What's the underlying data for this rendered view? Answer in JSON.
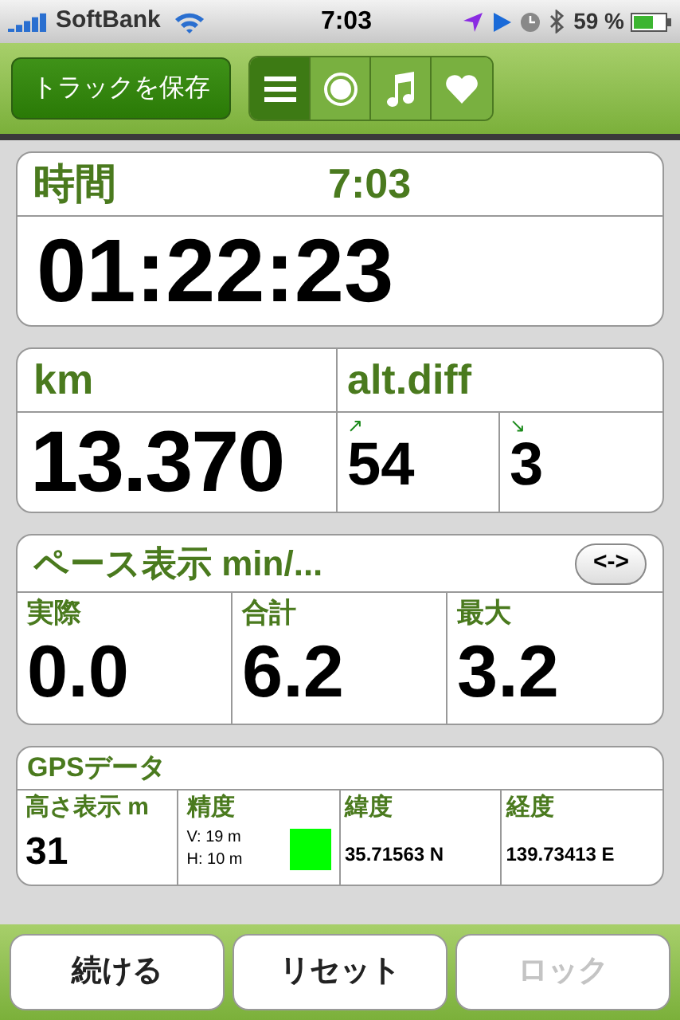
{
  "status_bar": {
    "carrier": "SoftBank",
    "time": "7:03",
    "battery": "59 %"
  },
  "toolbar": {
    "save_button": "トラックを保存",
    "tabs": [
      {
        "kind": "list",
        "selected": true
      },
      {
        "kind": "record",
        "selected": false
      },
      {
        "kind": "music",
        "selected": false
      },
      {
        "kind": "heart",
        "selected": false
      }
    ]
  },
  "time_card": {
    "label": "時間",
    "clock": "7:03",
    "value": "01:22:23"
  },
  "distance_card": {
    "label": "km",
    "value": "13.370",
    "alt_label": "alt.diff",
    "up_arrow": "↗",
    "up": "54",
    "down_arrow": "↘",
    "down": "3"
  },
  "pace_card": {
    "title": "ペース表示 min/...",
    "toggle": "<->",
    "cells": [
      {
        "label": "実際",
        "value": "0.0"
      },
      {
        "label": "合計",
        "value": "6.2"
      },
      {
        "label": "最大",
        "value": "3.2"
      }
    ]
  },
  "gps_card": {
    "title": "GPSデータ",
    "altitude_label": "高さ表示 m",
    "altitude": "31",
    "accuracy": {
      "label": "精度",
      "vertical": "V: 19 m",
      "horizontal": "H: 10 m",
      "color": "#00ff00"
    },
    "latitude_label": "緯度",
    "latitude": "35.71563 N",
    "longitude_label": "経度",
    "longitude": "139.73413 E"
  },
  "bottom_buttons": [
    {
      "label": "続ける",
      "disabled": false
    },
    {
      "label": "リセット",
      "disabled": false
    },
    {
      "label": "ロック",
      "disabled": true
    }
  ]
}
